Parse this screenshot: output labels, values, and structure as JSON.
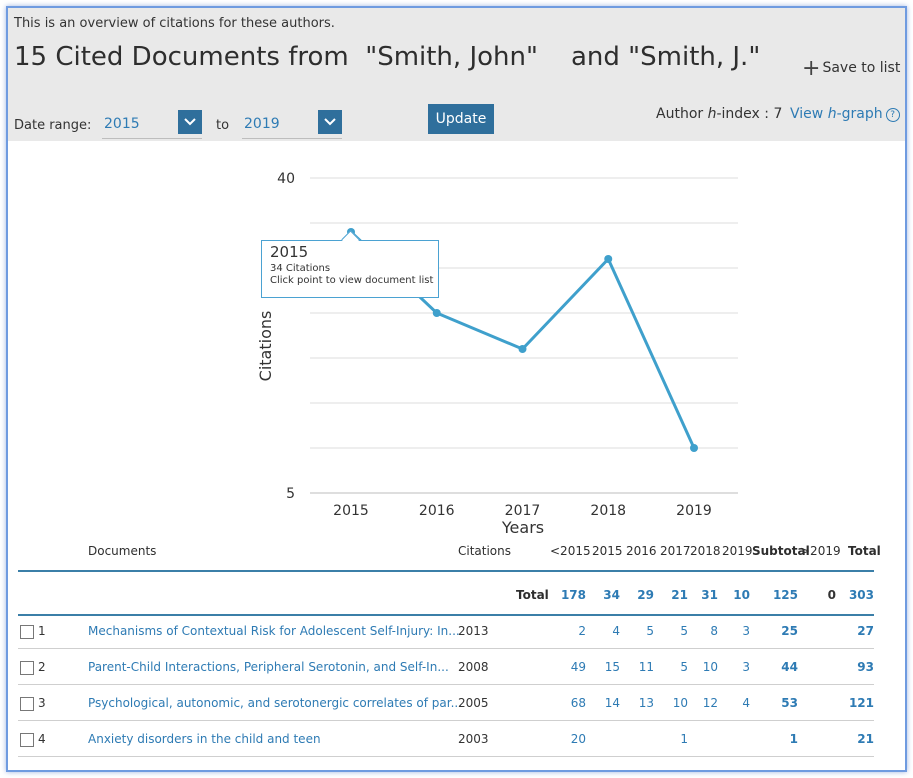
{
  "header": {
    "intro": "This is an overview of citations for these authors.",
    "title": "15 Cited Documents from  \"Smith, John\"    and \"Smith, J.\"",
    "save_to_list": "Save to list",
    "date_range_label": "Date range:",
    "from_year": "2015",
    "to_label": "to",
    "to_year": "2019",
    "update_label": "Update",
    "hindex_prefix": "Author ",
    "hindex_h": "h",
    "hindex_suffix": "-index : 7",
    "view_prefix": "View ",
    "view_h": "h",
    "view_suffix": "-graph"
  },
  "chart_data": {
    "type": "line",
    "x": [
      "2015",
      "2016",
      "2017",
      "2018",
      "2019"
    ],
    "values": [
      34,
      25,
      21,
      31,
      10
    ],
    "ylabel": "Citations",
    "xlabel": "Years",
    "ylim": [
      5,
      40
    ],
    "ytick_labels": [
      "40",
      "5"
    ],
    "color": "#3fa0cc",
    "grid": true
  },
  "tooltip": {
    "year": "2015",
    "citations": "34 Citations",
    "hint": "Click point to view document list"
  },
  "table": {
    "headers": {
      "documents": "Documents",
      "citations": "Citations",
      "lt2015": "<2015",
      "y2015": "2015",
      "y2016": "2016",
      "y2017": "2017",
      "y2018": "2018",
      "y2019": "2019",
      "subtotal": "Subtotal",
      "gt2019": ">2019",
      "total": "Total"
    },
    "totals": {
      "label": "Total",
      "lt2015": "178",
      "y2015": "34",
      "y2016": "29",
      "y2017": "21",
      "y2018": "31",
      "y2019": "10",
      "subtotal": "125",
      "gt2019": "0",
      "total": "303"
    },
    "rows": [
      {
        "idx": "1",
        "title": "Mechanisms of Contextual Risk for Adolescent Self-Injury: In...",
        "year": "2013",
        "lt2015": "2",
        "y2015": "4",
        "y2016": "5",
        "y2017": "5",
        "y2018": "8",
        "y2019": "3",
        "subtotal": "25",
        "total": "27"
      },
      {
        "idx": "2",
        "title": "Parent-Child Interactions, Peripheral Serotonin, and Self-In...",
        "year": "2008",
        "lt2015": "49",
        "y2015": "15",
        "y2016": "11",
        "y2017": "5",
        "y2018": "10",
        "y2019": "3",
        "subtotal": "44",
        "total": "93"
      },
      {
        "idx": "3",
        "title": "Psychological, autonomic, and serotonergic correlates of par...",
        "year": "2005",
        "lt2015": "68",
        "y2015": "14",
        "y2016": "13",
        "y2017": "10",
        "y2018": "12",
        "y2019": "4",
        "subtotal": "53",
        "total": "121"
      },
      {
        "idx": "4",
        "title": "Anxiety disorders in the child and teen",
        "year": "2003",
        "lt2015": "20",
        "y2015": "",
        "y2016": "",
        "y2017": "1",
        "y2018": "",
        "y2019": "",
        "subtotal": "1",
        "total": "21"
      }
    ]
  }
}
